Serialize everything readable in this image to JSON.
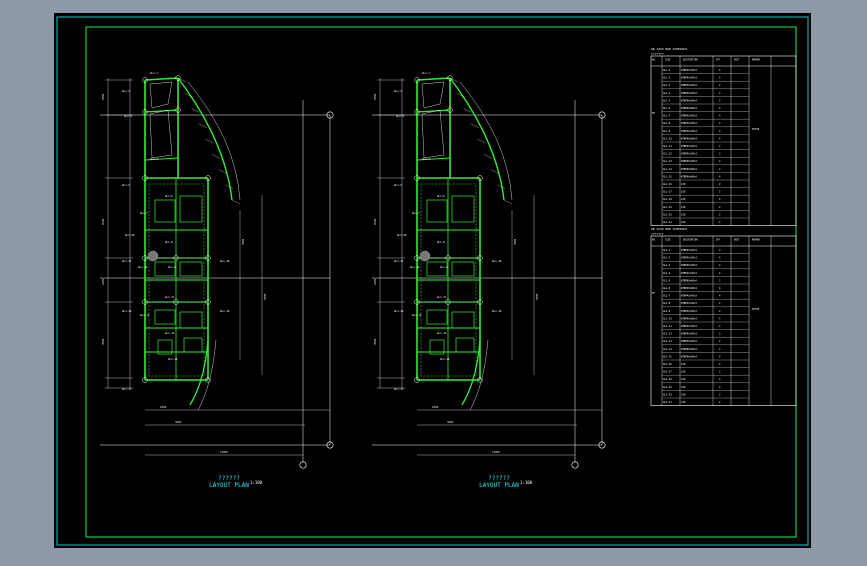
{
  "viewport": {
    "background": "#8e9aa8",
    "paper": "#000000"
  },
  "colors": {
    "frame": "#19c9c9",
    "border": "#22ee44",
    "beam": "#33ee33",
    "grid": "#ffffff",
    "dim": "#e8e8e8",
    "text": "#ffffff",
    "table": "#ffffff"
  },
  "plans": [
    {
      "title": "??????",
      "subtitle": "LAYOUT PLAN",
      "scale": "1:100"
    },
    {
      "title": "??????",
      "subtitle": "LAYOUT PLAN",
      "scale": "1:100"
    }
  ],
  "tables": [
    {
      "heading": "GB 1XXX BAR SCHEDULE",
      "subheading": "???????",
      "headers": [
        "NO.",
        "SIZE",
        "DESCRIPTION",
        "QTY",
        "UNIT",
        "REMARK"
      ],
      "remark": "SETUP",
      "group_label": "FF",
      "rows": [
        [
          "GL1-1",
          "WTBP45x45x3",
          "4"
        ],
        [
          "GL1-2",
          "WTBP45x45x3",
          "4"
        ],
        [
          "GL1-3",
          "WTBP45x45x3",
          "2"
        ],
        [
          "GL1-4",
          "WTBP45x45x3",
          "2"
        ],
        [
          "GL1-5",
          "WTBP60x60x4",
          "2"
        ],
        [
          "GL1-6",
          "WTBP60x60x4",
          "4"
        ],
        [
          "GL1-7",
          "WTBP45x45x3",
          "4"
        ],
        [
          "GL1-8",
          "WTBP45x45x3",
          "2"
        ],
        [
          "GL1-9",
          "WTBP45x45x3",
          "2"
        ],
        [
          "GL1-10",
          "WTBP60x60x4",
          "4"
        ],
        [
          "GL1-11",
          "WTBP45x45x3",
          "2"
        ],
        [
          "GL1-12",
          "WTBP45x45x3",
          "2"
        ],
        [
          "GL1-13",
          "WTBP45x45x3",
          "2"
        ],
        [
          "GL1-14",
          "WTBP60x60x4",
          "2"
        ],
        [
          "GL1-15",
          "WTBP60x60x4",
          "4"
        ],
        [
          "GL1-16",
          "L50",
          "2"
        ],
        [
          "GL1-17",
          "L50",
          "2"
        ],
        [
          "GL1-18",
          "L50",
          "4"
        ],
        [
          "GL1-19",
          "L50",
          "2"
        ],
        [
          "GL1-20",
          "L50",
          "2"
        ],
        [
          "GL1-21",
          "L50",
          "2"
        ]
      ]
    },
    {
      "heading": "GB 1XXX BAR SCHEDULE",
      "subheading": "???????",
      "headers": [
        "NO.",
        "SIZE",
        "DESCRIPTION",
        "QTY",
        "UNIT",
        "REMARK"
      ],
      "remark": "SETUP",
      "group_label": "FF",
      "rows": [
        [
          "GL2-1",
          "WTBP45x45x3",
          "4"
        ],
        [
          "GL2-2",
          "WTBP45x45x3",
          "4"
        ],
        [
          "GL2-3",
          "WTBP45x45x3",
          "2"
        ],
        [
          "GL2-4",
          "WTBP45x45x3",
          "2"
        ],
        [
          "GL2-5",
          "WTBP60x60x4",
          "2"
        ],
        [
          "GL2-6",
          "WTBP60x60x4",
          "4"
        ],
        [
          "GL2-7",
          "WTBP45x45x3",
          "4"
        ],
        [
          "GL2-8",
          "WTBP45x45x3",
          "2"
        ],
        [
          "GL2-9",
          "WTBP45x45x3",
          "2"
        ],
        [
          "GL2-10",
          "WTBP60x60x4",
          "4"
        ],
        [
          "GL2-11",
          "WTBP45x45x3",
          "2"
        ],
        [
          "GL2-12",
          "WTBP45x45x3",
          "2"
        ],
        [
          "GL2-13",
          "WTBP45x45x3",
          "2"
        ],
        [
          "GL2-14",
          "WTBP60x60x4",
          "2"
        ],
        [
          "GL2-15",
          "WTBP60x60x4",
          "4"
        ],
        [
          "GL2-16",
          "L50",
          "2"
        ],
        [
          "GL2-17",
          "L50",
          "2"
        ],
        [
          "GL2-18",
          "L50",
          "4"
        ],
        [
          "GL2-19",
          "L50",
          "2"
        ],
        [
          "GL2-20",
          "L50",
          "2"
        ],
        [
          "GL2-21",
          "L50",
          "2"
        ]
      ]
    }
  ]
}
